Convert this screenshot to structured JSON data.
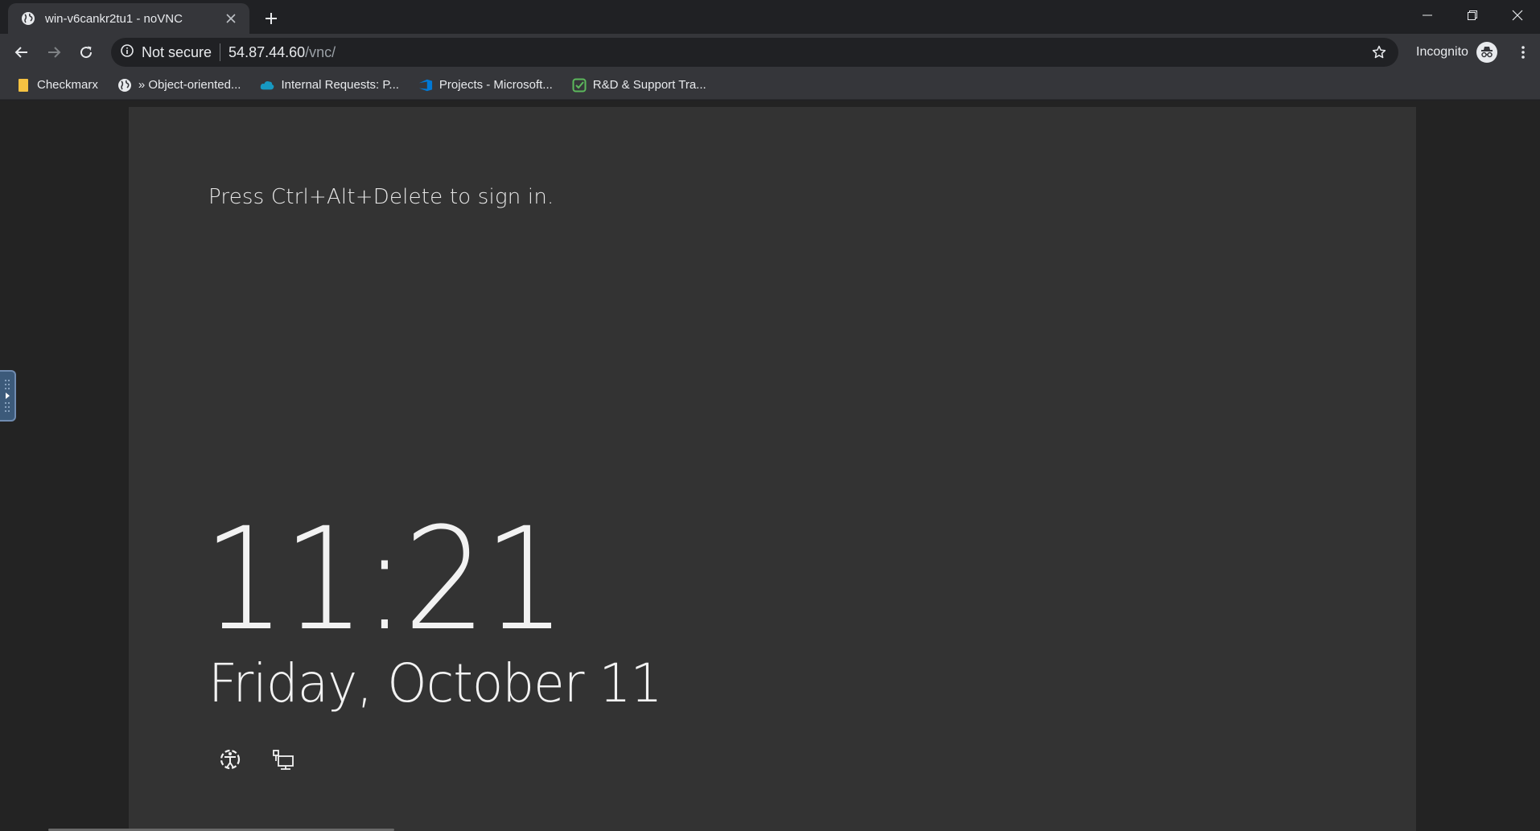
{
  "tab": {
    "title": "win-v6cankr2tu1 - noVNC",
    "favicon": "globe-icon"
  },
  "toolbar": {
    "security_label": "Not secure",
    "url_host": "54.87.44.60",
    "url_path": "/vnc/",
    "incognito_label": "Incognito"
  },
  "bookmarks": [
    {
      "label": "Checkmarx",
      "icon": "folder-icon",
      "color": "#f5c242"
    },
    {
      "label": "» Object-oriented...",
      "icon": "globe-icon",
      "color": "#e8eaed"
    },
    {
      "label": "Internal Requests: P...",
      "icon": "cloud-icon",
      "color": "#1798c1"
    },
    {
      "label": "Projects - Microsoft...",
      "icon": "azure-devops-icon",
      "color": "#0078d4"
    },
    {
      "label": "R&D & Support Tra...",
      "icon": "check-icon",
      "color": "#5cb85c"
    }
  ],
  "lockscreen": {
    "prompt": "Press Ctrl+Alt+Delete to sign in.",
    "time": "11:21",
    "date": "Friday, October 11",
    "status_icons": [
      "ease-of-access-icon",
      "network-icon"
    ]
  },
  "colors": {
    "chrome_frame": "#202124",
    "chrome_toolbar": "#35363a",
    "lockscreen_bg": "#333333",
    "lockscreen_text": "#f2f2f2"
  }
}
